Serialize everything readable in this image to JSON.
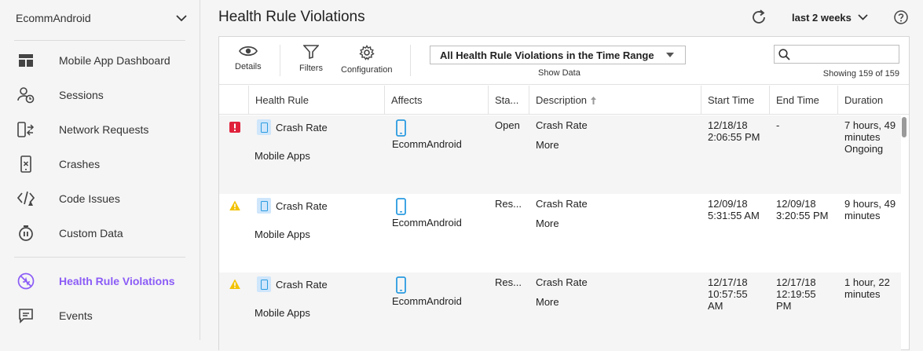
{
  "sidebar": {
    "app_name": "EcommAndroid",
    "items": [
      {
        "label": "Mobile App Dashboard",
        "icon": "dashboard-icon"
      },
      {
        "label": "Sessions",
        "icon": "sessions-icon"
      },
      {
        "label": "Network Requests",
        "icon": "network-requests-icon"
      },
      {
        "label": "Crashes",
        "icon": "crashes-icon"
      },
      {
        "label": "Code Issues",
        "icon": "code-issues-icon"
      },
      {
        "label": "Custom Data",
        "icon": "custom-data-icon"
      },
      {
        "label": "Health Rule Violations",
        "icon": "health-rule-icon",
        "active": true
      },
      {
        "label": "Events",
        "icon": "events-icon"
      }
    ]
  },
  "header": {
    "title": "Health Rule Violations",
    "time_range": "last 2 weeks"
  },
  "toolbar": {
    "details_label": "Details",
    "filters_label": "Filters",
    "configuration_label": "Configuration",
    "filter_value": "All Health Rule Violations in the Time Range",
    "show_data_label": "Show Data",
    "search_placeholder": "",
    "showing": "Showing 159 of 159"
  },
  "table": {
    "columns": [
      "Health Rule",
      "Affects",
      "Sta...",
      "Description",
      "Start Time",
      "End Time",
      "Duration"
    ],
    "rows": [
      {
        "severity": "critical",
        "rule": "Crash Rate",
        "rule_sub": "Mobile Apps",
        "affects": "EcommAndroid",
        "status": "Open",
        "description": "Crash Rate",
        "more": "More",
        "start_1": "12/18/18",
        "start_2": "2:06:55 PM",
        "start_3": "",
        "end_1": "-",
        "end_2": "",
        "end_3": "",
        "duration_1": "7 hours, 49",
        "duration_2": "minutes",
        "duration_3": "Ongoing"
      },
      {
        "severity": "warning",
        "rule": "Crash Rate",
        "rule_sub": "Mobile Apps",
        "affects": "EcommAndroid",
        "status": "Res...",
        "description": "Crash Rate",
        "more": "More",
        "start_1": "12/09/18",
        "start_2": "5:31:55 AM",
        "start_3": "",
        "end_1": "12/09/18",
        "end_2": "3:20:55 PM",
        "end_3": "",
        "duration_1": "9 hours, 49",
        "duration_2": "minutes",
        "duration_3": ""
      },
      {
        "severity": "warning",
        "rule": "Crash Rate",
        "rule_sub": "Mobile Apps",
        "affects": "EcommAndroid",
        "status": "Res...",
        "description": "Crash Rate",
        "more": "More",
        "start_1": "12/17/18",
        "start_2": "10:57:55",
        "start_3": "AM",
        "end_1": "12/17/18",
        "end_2": "12:19:55",
        "end_3": "PM",
        "duration_1": "1 hour, 22",
        "duration_2": "minutes",
        "duration_3": ""
      }
    ]
  },
  "colors": {
    "accent": "#8b5cf6",
    "link": "#2a9be0",
    "critical": "#e0223c",
    "warning": "#f2c200"
  }
}
